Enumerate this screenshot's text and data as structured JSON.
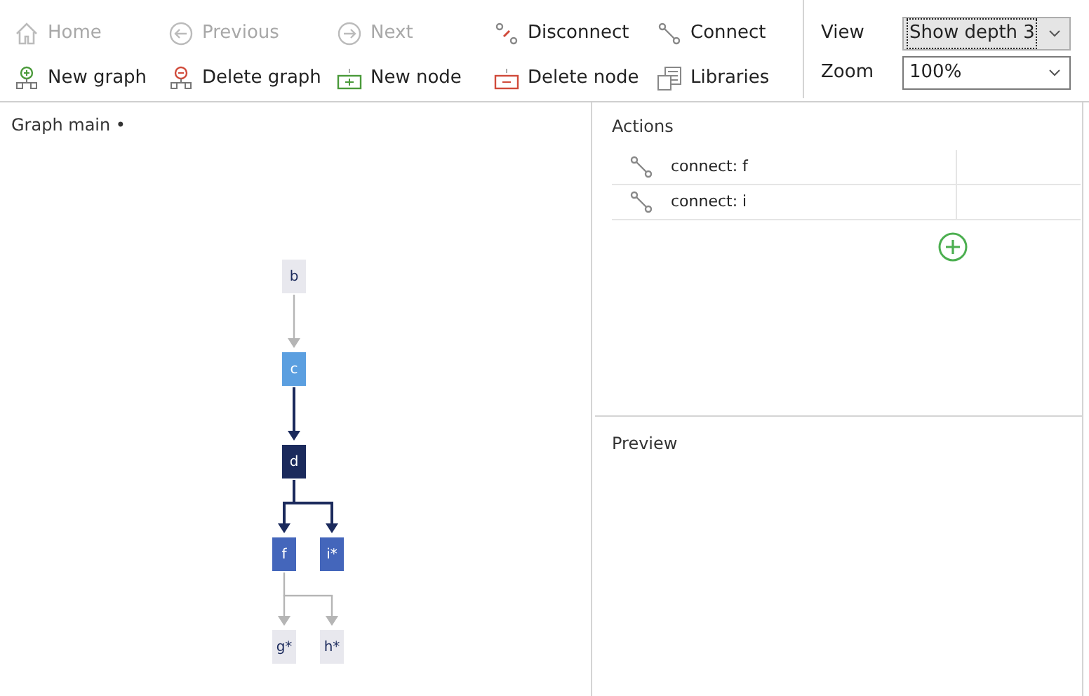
{
  "toolbar": {
    "rows": [
      [
        {
          "label": "Home",
          "disabled": true
        },
        {
          "label": "Previous",
          "disabled": true
        },
        {
          "label": "Next",
          "disabled": true
        },
        {
          "label": "Disconnect",
          "disabled": false
        },
        {
          "label": "Connect",
          "disabled": false
        }
      ],
      [
        {
          "label": "New graph",
          "disabled": false
        },
        {
          "label": "Delete graph",
          "disabled": false
        },
        {
          "label": "New node",
          "disabled": false
        },
        {
          "label": "Delete node",
          "disabled": false
        },
        {
          "label": "Libraries",
          "disabled": false
        }
      ]
    ],
    "view": {
      "label": "View",
      "value": "Show depth 3",
      "focused": true
    },
    "zoom": {
      "label": "Zoom",
      "value": "100%",
      "focused": false
    }
  },
  "graph": {
    "title": "Graph main •",
    "nodes": [
      {
        "label": "b",
        "color": "#e8e8ee",
        "children": [
          {
            "label": "c",
            "color": "#5b9fe0",
            "highlighted_link": false,
            "children": [
              {
                "label": "d",
                "color": "#1b2a5c",
                "highlighted_link": true,
                "children": [
                  {
                    "label": "f",
                    "color": "#4466bb",
                    "highlighted_link": true,
                    "children": [
                      {
                        "label": "g*",
                        "color": "#e8e8ee",
                        "highlighted_link": false
                      },
                      {
                        "label": "h*",
                        "color": "#e8e8ee",
                        "highlighted_link": false
                      }
                    ]
                  },
                  {
                    "label": "i*",
                    "color": "#4466bb",
                    "highlighted_link": true
                  }
                ]
              }
            ]
          }
        ]
      }
    ]
  },
  "actions": {
    "title": "Actions",
    "items": [
      {
        "label": "connect: f"
      },
      {
        "label": "connect: i"
      }
    ]
  },
  "preview": {
    "title": "Preview"
  }
}
